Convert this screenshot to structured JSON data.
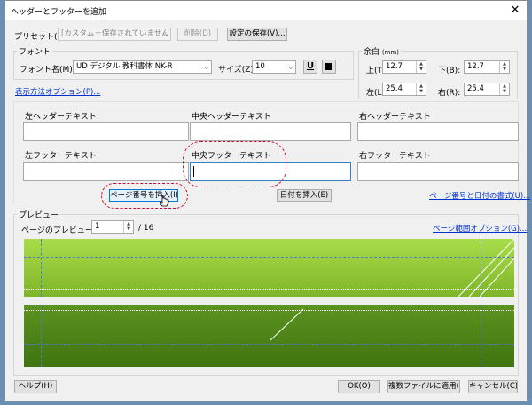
{
  "window": {
    "title": "ヘッダーとフッターを追加",
    "close": "✕"
  },
  "preset": {
    "label": "プリセット(S):",
    "value": "[カスタム－保存されていません]",
    "delete_label": "削除(D)",
    "save_label": "設定の保存(V)..."
  },
  "font": {
    "group_label": "フォント",
    "name_label": "フォント名(M):",
    "name_value": "UD デジタル 教科書体 NK-R",
    "size_label": "サイズ(Z):",
    "size_value": "10",
    "underline_icon": "U",
    "color_swatch": "#000000"
  },
  "margins": {
    "group_label": "余白",
    "unit": "(mm)",
    "top_label": "上(T)",
    "top_value": "12.7",
    "bottom_label": "下(B):",
    "bottom_value": "12.7",
    "left_label": "左(L)",
    "left_value": "25.4",
    "right_label": "右(R):",
    "right_value": "25.4"
  },
  "display_options_link": "表示方法オプション(P)...",
  "fields": {
    "left_header": "左ヘッダーテキスト",
    "center_header": "中央ヘッダーテキスト",
    "right_header": "右ヘッダーテキスト",
    "left_footer": "左フッターテキスト",
    "center_footer": "中央フッターテキスト",
    "right_footer": "右フッターテキスト"
  },
  "insert": {
    "page_number_label": "ページ番号を挿入(I)",
    "date_label": "日付を挿入(E)",
    "format_link": "ページ番号と日付の書式(U)..."
  },
  "preview": {
    "group_label": "プレビュー",
    "page_label": "ページのプレビュー(E)",
    "page_value": "1",
    "total": "/ 16",
    "range_link": "ページ範囲オプション(G)..."
  },
  "footer_buttons": {
    "help": "ヘルプ(H)",
    "ok": "OK(O)",
    "apply_multiple": "複数ファイルに適用(A)",
    "cancel": "キャンセル(C)"
  },
  "colors": {
    "accent_link": "#0033cc",
    "highlight": "#c8102e",
    "banner_light": "#9ed13f",
    "banner_dark": "#4c7f14"
  }
}
